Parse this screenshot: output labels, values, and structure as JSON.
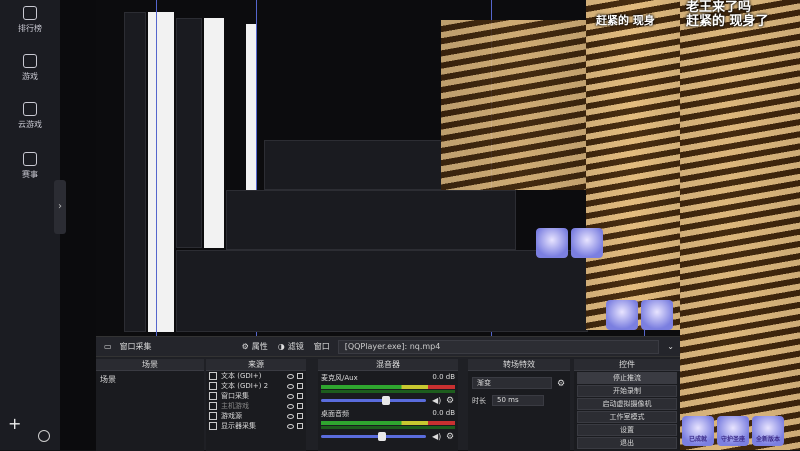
{
  "sidebar": {
    "items": [
      {
        "label": "排行榜",
        "icon": "trophy-list-icon"
      },
      {
        "label": "游戏",
        "icon": "gamepad-icon"
      },
      {
        "label": "云游戏",
        "icon": "cloud-game-icon"
      },
      {
        "label": "赛事",
        "icon": "trophy-icon"
      }
    ],
    "expand_glyph": "›",
    "add_glyph": "+"
  },
  "overlay": {
    "danmaku": [
      "赶紧的 现身",
      "老王来了吗",
      "赶紧的 现身了"
    ],
    "badges": [
      "守护圣座",
      "全新版本",
      "已成就"
    ]
  },
  "obs": {
    "toolbar": {
      "source_name": "窗口采集",
      "properties_label": "属性",
      "filters_label": "滤镜",
      "window_label": "窗口",
      "window_value": "[QQPlayer.exe]: nq.mp4"
    },
    "scenes": {
      "header": "场景",
      "items": [
        "场景"
      ]
    },
    "sources": {
      "header": "来源",
      "items": [
        {
          "label": "文本 (GDI+)",
          "dim": false
        },
        {
          "label": "文本 (GDI+) 2",
          "dim": false
        },
        {
          "label": "窗口采集",
          "dim": false
        },
        {
          "label": "主机游戏",
          "dim": true
        },
        {
          "label": "游戏源",
          "dim": false
        },
        {
          "label": "显示器采集",
          "dim": false
        }
      ]
    },
    "mixer": {
      "header": "混音器",
      "channels": [
        {
          "name": "麦克风/Aux",
          "db": "0.0 dB",
          "level": 0.62
        },
        {
          "name": "桌面音频",
          "db": "0.0 dB",
          "level": 0.58
        }
      ]
    },
    "transitions": {
      "header": "转场特效",
      "selected": "渐变",
      "duration_label": "时长",
      "duration_value": "50 ms"
    },
    "controls": {
      "header": "控件",
      "buttons": [
        "停止推流",
        "开始录制",
        "启动虚拟摄像机",
        "工作室模式",
        "设置",
        "退出"
      ]
    }
  },
  "colors": {
    "rail_bg": "#1b1c22",
    "obs_bg": "#1f2025",
    "accent_slider": "#5a6cdc",
    "meter_green": "#2fa62f"
  }
}
